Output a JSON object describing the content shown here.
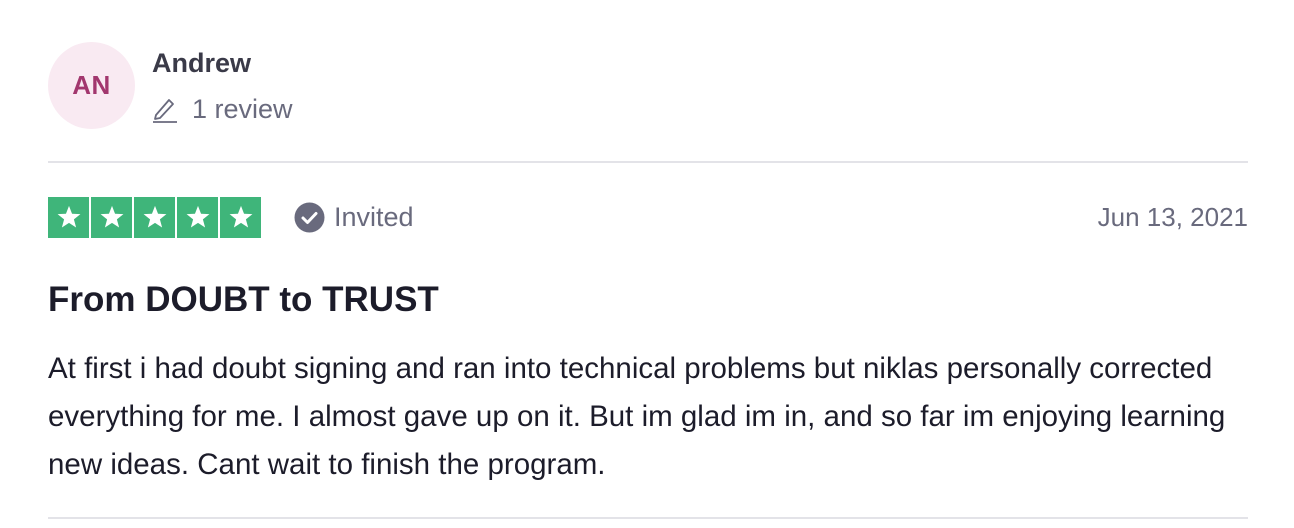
{
  "consumer": {
    "initials": "AN",
    "name": "Andrew",
    "review_count": "1 review",
    "avatar_bg": "#f9eaf2",
    "avatar_text_color": "#a2376e"
  },
  "review": {
    "rating": 5,
    "max_rating": 5,
    "star_color": "#3fb57a",
    "verification_label": "Invited",
    "date": "Jun 13, 2021",
    "title": "From DOUBT to TRUST",
    "body": "At first i had doubt signing and ran into technical problems but niklas personally corrected everything for me. I almost gave up on it. But im glad im in, and so far im enjoying learning new ideas. Cant wait to finish the program."
  },
  "icons": {
    "pencil": "pencil-icon",
    "star": "star-icon",
    "verified": "check-circle-icon"
  }
}
